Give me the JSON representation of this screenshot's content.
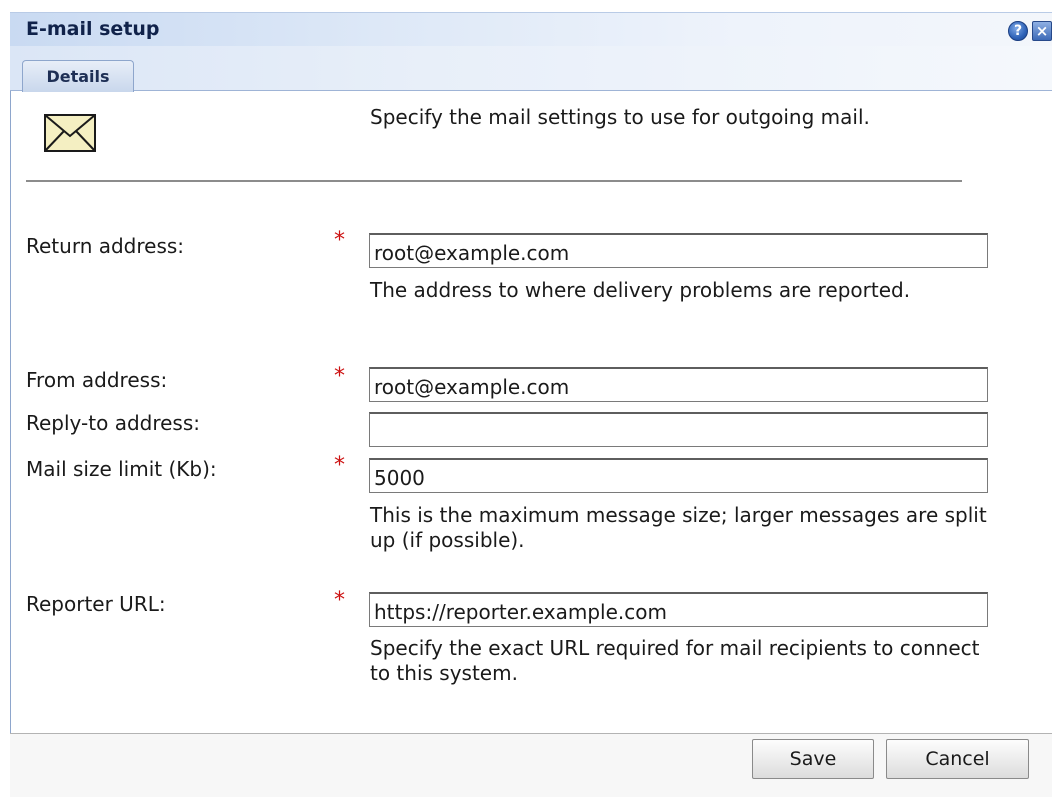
{
  "dialog": {
    "title": "E-mail setup",
    "help_label": "?",
    "close_label": "×"
  },
  "tabs": [
    {
      "label": "Details"
    }
  ],
  "intro": "Specify the mail settings to use for outgoing mail.",
  "required_marker": "*",
  "fields": {
    "return_address": {
      "label": "Return address:",
      "value": "root@example.com",
      "hint": "The address to where delivery problems are reported."
    },
    "from_address": {
      "label": "From address:",
      "value": "root@example.com"
    },
    "reply_to_address": {
      "label": "Reply-to address:",
      "value": ""
    },
    "mail_size_limit": {
      "label": "Mail size limit (Kb):",
      "value": "5000",
      "hint": "This is the maximum message size; larger messages are split up (if possible)."
    },
    "reporter_url": {
      "label": "Reporter URL:",
      "value": "https://reporter.example.com",
      "hint": "Specify the exact URL required for mail recipients to connect to this system."
    }
  },
  "buttons": {
    "save": "Save",
    "cancel": "Cancel"
  },
  "icons": {
    "envelope": "envelope-icon",
    "help": "help-icon",
    "close": "close-icon"
  },
  "colors": {
    "required": "#cc1111",
    "title_text": "#10224a",
    "titlebar": "#c9daf2"
  }
}
